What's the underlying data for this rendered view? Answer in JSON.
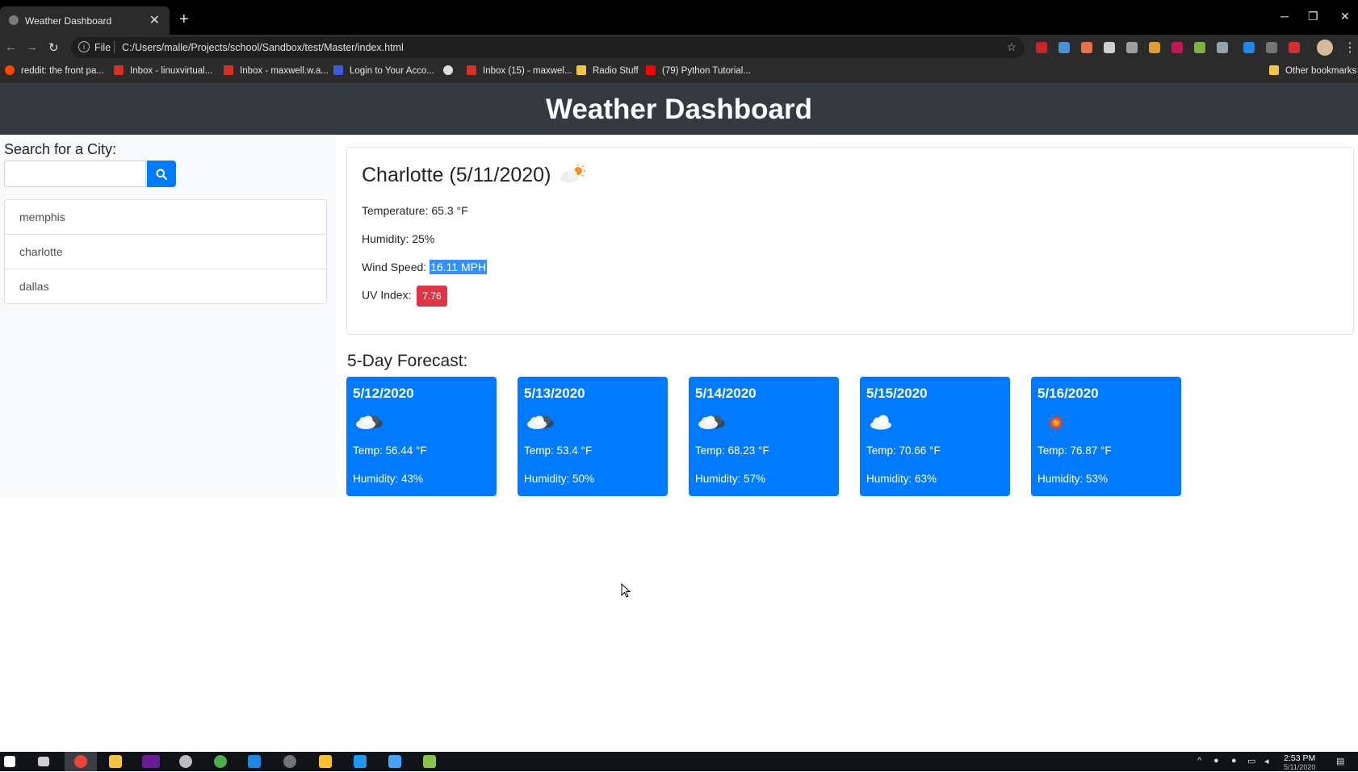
{
  "browser": {
    "tab_title": "Weather Dashboard",
    "tab_close": "✕",
    "new_tab": "+",
    "window_controls": {
      "minimize": "─",
      "restore": "❐",
      "close": "✕"
    },
    "scheme": "File",
    "url": "C:/Users/malle/Projects/school/Sandbox/test/Master/index.html",
    "bookmarks": [
      {
        "label": "reddit: the front pa...",
        "color": "#ff4500"
      },
      {
        "label": "Inbox - linuxvirtual...",
        "color": "#d93025"
      },
      {
        "label": "Inbox - maxwell.w.a...",
        "color": "#d93025"
      },
      {
        "label": "Login to Your Acco...",
        "color": "#3b5bdb"
      },
      {
        "label": "",
        "color": "#dddddd"
      },
      {
        "label": "Inbox (15) - maxwel...",
        "color": "#d93025"
      },
      {
        "label": "Radio Stuff",
        "color": "#f4c542"
      },
      {
        "label": "(79) Python Tutorial...",
        "color": "#ff0000"
      }
    ],
    "other_bookmarks": "Other bookmarks"
  },
  "page": {
    "title": "Weather Dashboard",
    "search": {
      "label": "Search for a City:",
      "value": "",
      "placeholder": ""
    },
    "history": [
      "memphis",
      "charlotte",
      "dallas"
    ],
    "current": {
      "title": "Charlotte (5/11/2020)",
      "icon": "partly-cloudy-icon",
      "temperature_label": "Temperature: ",
      "temperature": "65.3 °F",
      "humidity_label": "Humidity: ",
      "humidity": "25%",
      "wind_label": "Wind Speed: ",
      "wind": "16.11 MPH",
      "uv_label": "UV Index: ",
      "uv": "7.76",
      "uv_color": "#dc3545"
    },
    "forecast_title": "5-Day Forecast:",
    "forecast": [
      {
        "date": "5/12/2020",
        "icon": "rain-cloud-icon",
        "temp": "Temp: 56.44 °F",
        "humidity": "Humidity: 43%"
      },
      {
        "date": "5/13/2020",
        "icon": "rain-cloud-icon",
        "temp": "Temp: 53.4 °F",
        "humidity": "Humidity: 50%"
      },
      {
        "date": "5/14/2020",
        "icon": "rain-cloud-icon",
        "temp": "Temp: 68.23 °F",
        "humidity": "Humidity: 57%"
      },
      {
        "date": "5/15/2020",
        "icon": "cloud-icon",
        "temp": "Temp: 70.66 °F",
        "humidity": "Humidity: 63%"
      },
      {
        "date": "5/16/2020",
        "icon": "sun-icon",
        "temp": "Temp: 76.87 °F",
        "humidity": "Humidity: 53%"
      }
    ],
    "accent_color": "#007bff",
    "header_color": "#343a40"
  },
  "taskbar": {
    "time": "2:53 PM",
    "date": "5/11/2020"
  }
}
